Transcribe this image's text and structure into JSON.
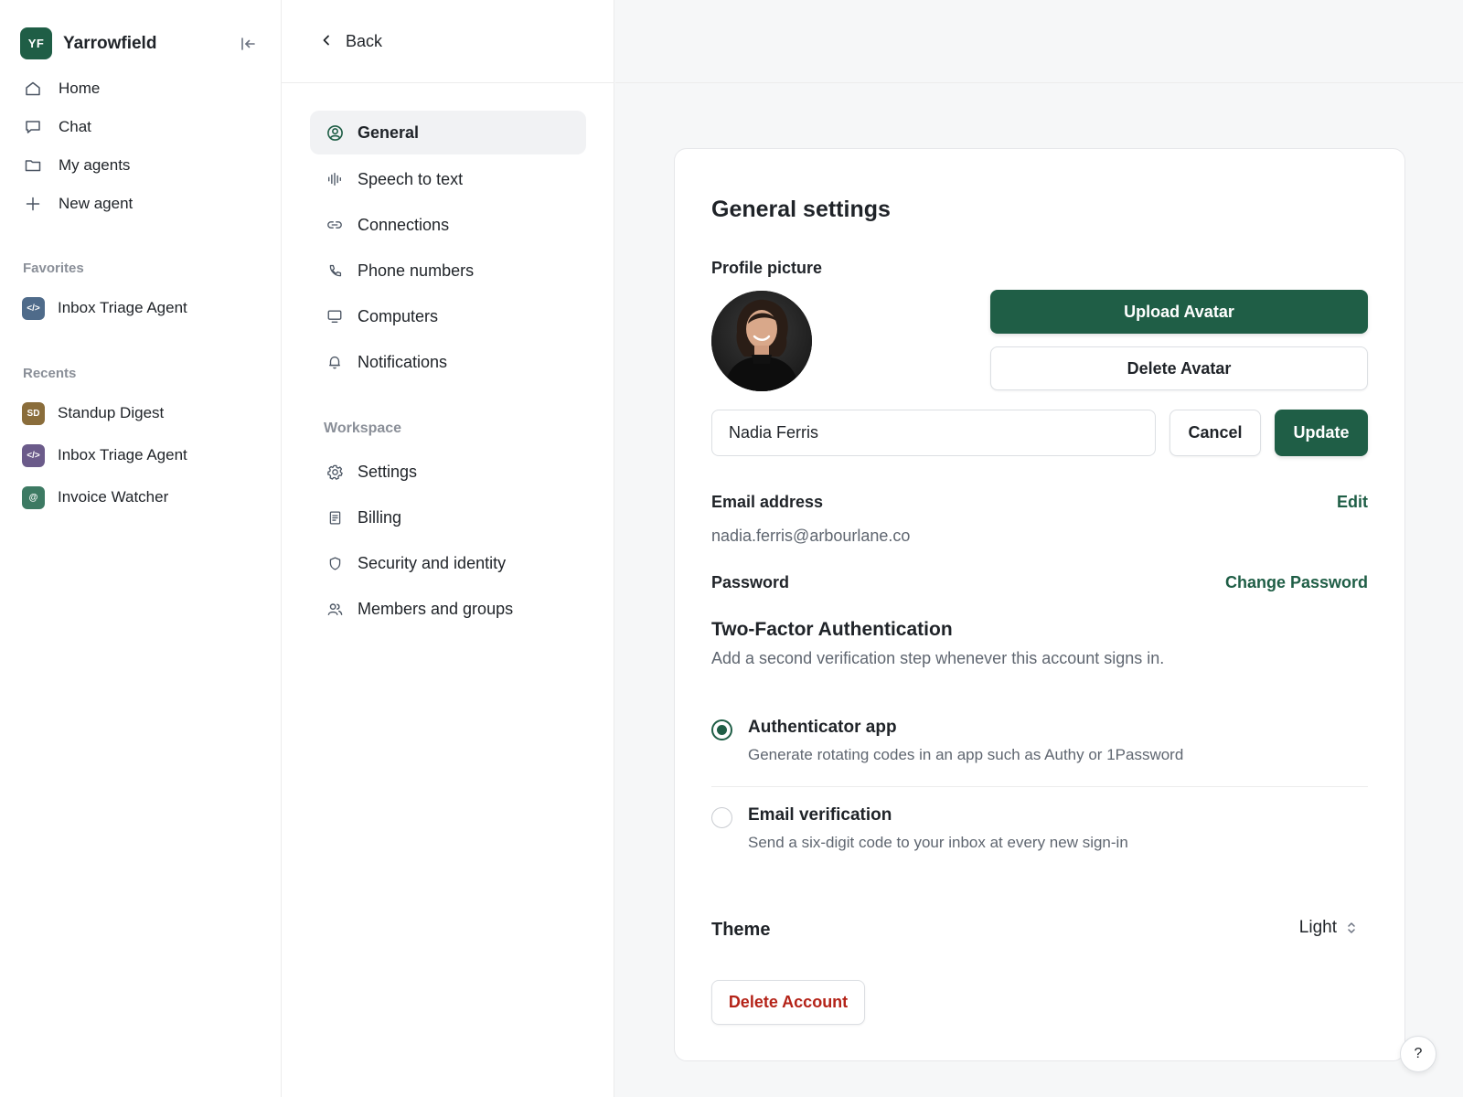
{
  "brand": {
    "initials": "YF",
    "name": "Yarrowfield",
    "color": "#1f5e46"
  },
  "nav": [
    {
      "icon": "home-icon",
      "label": "Home"
    },
    {
      "icon": "chat-icon",
      "label": "Chat"
    },
    {
      "icon": "folder-icon",
      "label": "My agents"
    },
    {
      "icon": "plus-icon",
      "label": "New agent"
    }
  ],
  "favorites": {
    "label": "Favorites",
    "items": [
      {
        "badge": "</>",
        "badge_color": "#4f6b8a",
        "label": "Inbox Triage Agent"
      }
    ]
  },
  "recents": {
    "label": "Recents",
    "items": [
      {
        "badge": "SD",
        "badge_color": "#8a6d3b",
        "label": "Standup Digest"
      },
      {
        "badge": "</>",
        "badge_color": "#6b5b8a",
        "label": "Inbox Triage Agent"
      },
      {
        "badge": "@",
        "badge_color": "#3d7a63",
        "label": "Invoice Watcher"
      }
    ]
  },
  "settings_nav": {
    "back_label": "Back",
    "items": [
      {
        "icon": "user-circle-icon",
        "label": "General",
        "active": true
      },
      {
        "icon": "waveform-icon",
        "label": "Speech to text"
      },
      {
        "icon": "link-icon",
        "label": "Connections"
      },
      {
        "icon": "phone-icon",
        "label": "Phone numbers"
      },
      {
        "icon": "monitor-icon",
        "label": "Computers"
      },
      {
        "icon": "bell-icon",
        "label": "Notifications"
      }
    ],
    "workspace_label": "Workspace",
    "workspace_items": [
      {
        "icon": "gear-icon",
        "label": "Settings"
      },
      {
        "icon": "receipt-icon",
        "label": "Billing"
      },
      {
        "icon": "shield-icon",
        "label": "Security and identity"
      },
      {
        "icon": "users-icon",
        "label": "Members and groups"
      }
    ]
  },
  "general": {
    "title": "General settings",
    "profile_label": "Profile picture",
    "upload_label": "Upload Avatar",
    "delete_avatar_label": "Delete Avatar",
    "name_value": "Nadia Ferris",
    "cancel_label": "Cancel",
    "update_label": "Update",
    "email_label": "Email address",
    "email_edit": "Edit",
    "email_value": "nadia.ferris@arbourlane.co",
    "password_label": "Password",
    "change_password": "Change Password",
    "tfa_title": "Two-Factor Authentication",
    "tfa_desc": "Add a second verification step whenever this account signs in.",
    "tfa_options": [
      {
        "title": "Authenticator app",
        "desc": "Generate rotating codes in an app such as Authy or 1Password",
        "selected": true
      },
      {
        "title": "Email verification",
        "desc": "Send a six-digit code to your inbox at every new sign-in",
        "selected": false
      }
    ],
    "theme_label": "Theme",
    "theme_value": "Light",
    "delete_account": "Delete Account"
  },
  "help_label": "?",
  "colors": {
    "accent": "#1f5e46",
    "danger": "#b42318"
  }
}
